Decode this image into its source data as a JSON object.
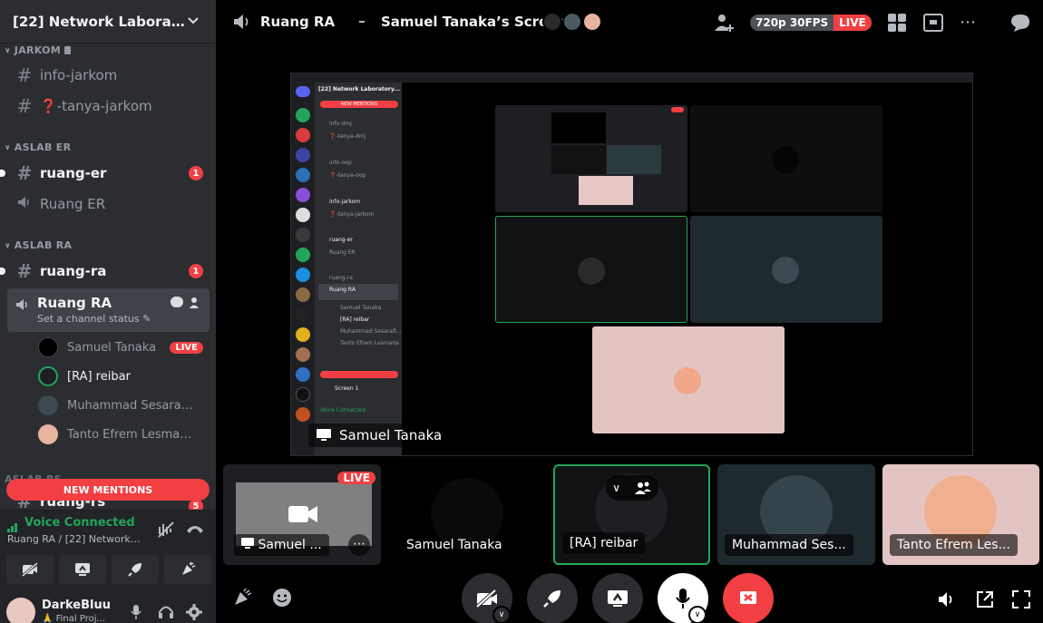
{
  "sidebar": {
    "server_name": "[22] Network Laboratory...",
    "categories": {
      "jarkom": "JARKOM",
      "aslab_er": "ASLAB ER",
      "aslab_ra": "ASLAB RA",
      "aslab_rs": "ASLAB RS"
    },
    "channels": {
      "info_jarkom": "info-jarkom",
      "tanya_jarkom": "❓-tanya-jarkom",
      "ruang_er": "ruang-er",
      "ruang_er_badge": "1",
      "voice_ruang_er": "Ruang ER",
      "ruang_ra": "ruang-ra",
      "ruang_ra_badge": "1",
      "voice_ruang_ra": "Ruang RA",
      "voice_ruang_ra_status": "Set a channel status",
      "ruang_rs": "ruang-rs",
      "ruang_rs_badge": "5"
    },
    "voice_users": [
      {
        "name": "Samuel Tanaka",
        "live": "LIVE"
      },
      {
        "name": "[RA] reibar"
      },
      {
        "name": "Muhammad Sesarafli ..."
      },
      {
        "name": "Tanto Efrem Lesmana"
      }
    ],
    "new_mentions": "NEW MENTIONS",
    "voice_panel": {
      "status": "Voice Connected",
      "location": "Ruang RA / [22] Network L..."
    },
    "user_panel": {
      "username": "DarkeBluu",
      "status": "🙏 Final Proj..."
    }
  },
  "topbar": {
    "channel_name": "Ruang RA",
    "screen_title": "Samuel Tanaka’s Screen",
    "quality": "720p 30FPS",
    "live": "LIVE"
  },
  "stream": {
    "presenter": "Samuel Tanaka",
    "inner": {
      "server_name": "[22] Network Laboratory...",
      "new_mentions": "NEW MENTIONS",
      "channels": [
        "info-dmj",
        "❓-tanya-dmj",
        "info-oop",
        "❓-tanya-oop",
        "info-jarkom",
        "❓-tanya-jarkom",
        "ruang-er",
        "Ruang ER",
        "ruang-ra",
        "Ruang RA"
      ],
      "voice_users": [
        "Samuel Tanaka",
        "[RA] reibar",
        "Muhammad Sesarafi...",
        "Tanto Efrem Lesmana"
      ],
      "voice_connected": "Voice Connected",
      "screen": "Screen 1"
    }
  },
  "tiles": [
    {
      "label": "Samuel ...",
      "badge": "LIVE"
    },
    {
      "label": "Samuel Tanaka"
    },
    {
      "label": "[RA] reibar"
    },
    {
      "label": "Muhammad Ses..."
    },
    {
      "label": "Tanto Efrem Les..."
    }
  ],
  "colors": {
    "accent_red": "#f23f43",
    "green": "#23a559",
    "sidebar_bg": "#2b2d31",
    "panel_bg": "#232428"
  }
}
